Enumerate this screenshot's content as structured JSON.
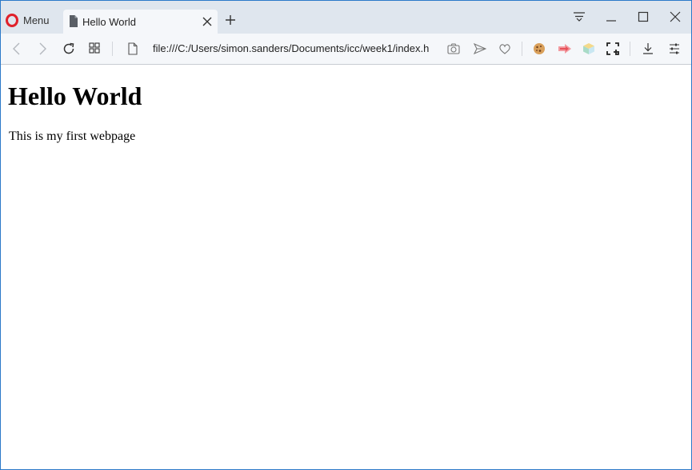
{
  "browser": {
    "menu_label": "Menu",
    "tab": {
      "title": "Hello World"
    },
    "address": "file:///C:/Users/simon.sanders/Documents/icc/week1/index.h",
    "icons": {
      "logo": "opera-logo-icon",
      "page": "page-icon",
      "close": "close-icon",
      "new_tab": "plus-icon",
      "tab_menu": "tab-menu-icon",
      "minimize": "minimize-icon",
      "maximize": "maximize-icon",
      "window_close": "window-close-icon",
      "back": "back-icon",
      "forward": "forward-icon",
      "reload": "reload-icon",
      "speed_dial": "speed-dial-icon",
      "snapshot": "camera-icon",
      "send": "send-icon",
      "bookmark": "heart-icon",
      "cookie": "cookie-icon",
      "extension_red": "red-extension-icon",
      "extension_cube": "cube-extension-icon",
      "snapshot_crop": "crop-icon",
      "download": "download-icon",
      "easy_setup": "settings-sliders-icon"
    },
    "colors": {
      "opera_red": "#e0212b",
      "title_bar": "#dfe6ee",
      "toolbar": "#f5f7fa"
    }
  },
  "page": {
    "heading": "Hello World",
    "paragraph": "This is my first webpage"
  }
}
